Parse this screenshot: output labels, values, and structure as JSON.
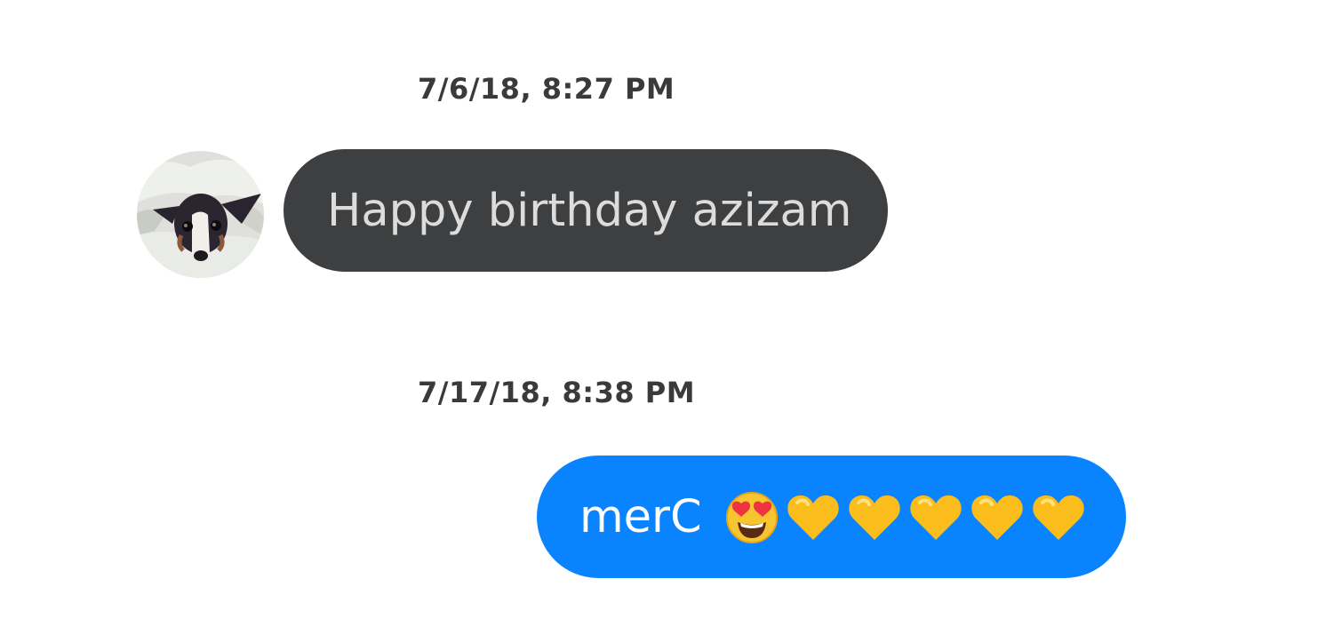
{
  "conversation": {
    "messages": [
      {
        "timestamp": "7/6/18, 8:27 PM",
        "direction": "incoming",
        "text": "Happy birthday azizam",
        "avatar_icon": "dog-photo-avatar"
      },
      {
        "timestamp": "7/17/18, 8:38 PM",
        "direction": "outgoing",
        "text": "merC",
        "emojis": [
          "smiling-face-with-heart-eyes",
          "yellow-heart",
          "yellow-heart",
          "yellow-heart",
          "yellow-heart",
          "yellow-heart"
        ]
      }
    ]
  },
  "colors": {
    "incoming_bubble": "#3e3f41",
    "incoming_text": "#dcdcdc",
    "outgoing_bubble": "#0a84fe",
    "outgoing_text": "#ffffff",
    "timestamp_text": "#3a3a3a",
    "background": "#ffffff"
  }
}
